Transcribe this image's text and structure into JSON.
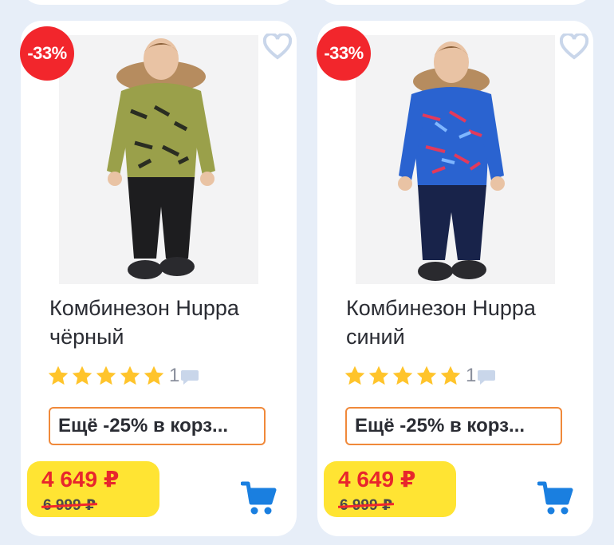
{
  "colors": {
    "background": "#e7eef8",
    "discount_badge": "#f2262c",
    "price_highlight": "#ffe433",
    "price_new": "#e8262c",
    "promo_border": "#f0893a",
    "star": "#ffc42b",
    "cart_icon": "#1a7fe0"
  },
  "products": [
    {
      "discount": "-33%",
      "title_line1": "Комбинезон Huppa",
      "title_line2": "чёрный",
      "rating_stars": 5,
      "review_count": "1",
      "promo": "Ещё -25% в корз...",
      "price_new": "4 649 ₽",
      "price_old": "6 999 ₽",
      "jacket_color": "#9aa04a",
      "pants_color": "#1d1d1f"
    },
    {
      "discount": "-33%",
      "title_line1": "Комбинезон Huppa",
      "title_line2": "синий",
      "rating_stars": 5,
      "review_count": "1",
      "promo": "Ещё -25% в корз...",
      "price_new": "4 649 ₽",
      "price_old": "6 999 ₽",
      "jacket_color": "#2a63d0",
      "pants_color": "#18234a"
    }
  ]
}
